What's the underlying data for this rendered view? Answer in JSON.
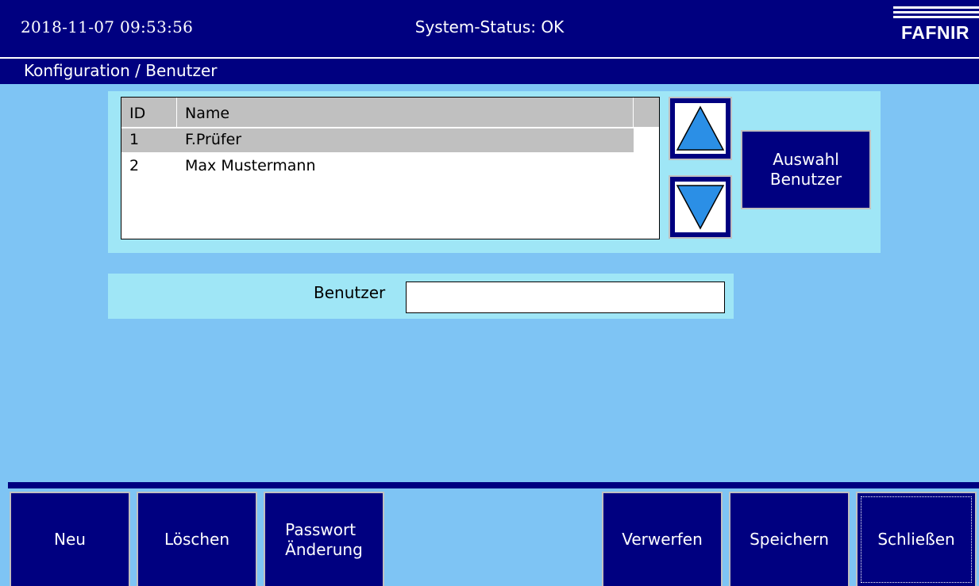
{
  "header": {
    "datetime": "2018-11-07  09:53:56",
    "status": "System-Status: OK",
    "logo": "FAFNIR"
  },
  "breadcrumb": "Konfiguration / Benutzer",
  "user_list": {
    "columns": [
      "ID",
      "Name"
    ],
    "rows": [
      {
        "id": "1",
        "name": "F.Prüfer",
        "selected": true
      },
      {
        "id": "2",
        "name": "Max Mustermann",
        "selected": false
      }
    ]
  },
  "buttons": {
    "scroll_up_icon": "triangle-up-icon",
    "scroll_down_icon": "triangle-down-icon",
    "select_user": "Auswahl\nBenutzer"
  },
  "form": {
    "user_label": "Benutzer",
    "user_value": ""
  },
  "footer": {
    "new": "Neu",
    "delete": "Löschen",
    "password_change": "Passwort\nÄnderung",
    "discard": "Verwerfen",
    "save": "Speichern",
    "close": "Schließen"
  },
  "colors": {
    "background": "#7ec4f4",
    "panel": "#9fe6f6",
    "navy": "#000080",
    "arrow": "#2b8fe6",
    "selection": "#c0c0c0"
  }
}
